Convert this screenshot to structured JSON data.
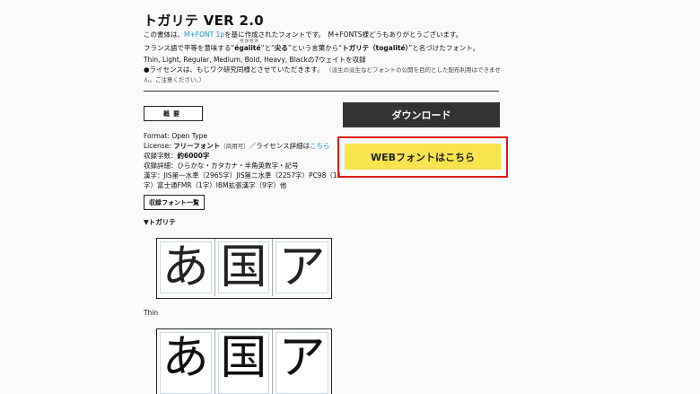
{
  "font": {
    "title": "トガリテ VER 2.0",
    "intro_prefix": "この書体は、",
    "intro_link": "M+FONT 1p",
    "intro_suffix": "を基に作成されたフォントです。　M+FONTS様どうもありがとうございます。",
    "desc_prefix": "フランス語で平等を意味する“",
    "desc_word1": "égalité",
    "desc_ruby": "せかせか",
    "desc_mid1": "”と“",
    "desc_word2": "尖る",
    "desc_mid2": "”という言葉から“",
    "desc_word3": "トガリテ（togalité）",
    "desc_suffix": "”と名づけたフォント。",
    "weights_line": "Thin, Light, Regular, Medium, Bold, Heavy, Blackの7ウェイトを収録",
    "license_note_main": "●ライセンスは、もじワク研究同様とさせていただきます。",
    "license_note_small": "（派生の派生などフォントの公開を目的とした配布利用はできませ",
    "license_note_cont": "ん。ご注意ください。）"
  },
  "summary": {
    "button_label": "概要",
    "format": "Format: Open Type",
    "license_prefix": "License: ",
    "license_value": "フリーフォント",
    "license_small": "（商用可）",
    "license_mid": "／ライセンス詳細は",
    "license_link": "こちら",
    "count_label": "収録字数：",
    "count_value": "約6000字",
    "detail_line": "収録詳細：ひらかな・カタカナ・半角英数字・記号",
    "kanji_line1": "漢字：JIS第一水準（2965字）JIS第二水準（2257字）PC98（11",
    "kanji_line2": "字）富士通FMR（1字）IBM拡張漢字（9字）他",
    "list_button": "収録フォント一覧"
  },
  "actions": {
    "download_label": "ダウンロード",
    "webfont_label": "WEBフォントはこちら",
    "highlight_color": "#e01818",
    "webfont_color": "#f7e44f",
    "download_color": "#333333"
  },
  "samples": {
    "section_title": "▼トガリテ",
    "glyphs": [
      "あ",
      "国",
      "ア"
    ],
    "thin_label": "Thin"
  }
}
